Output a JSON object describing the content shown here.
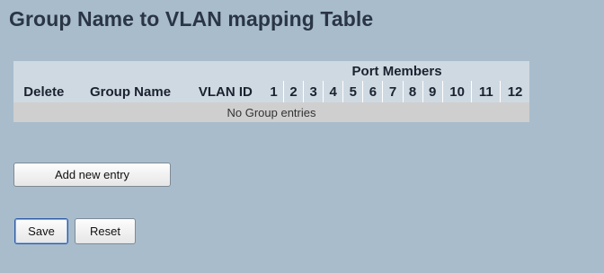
{
  "page": {
    "title": "Group Name to VLAN mapping Table"
  },
  "table": {
    "columns": {
      "delete": "Delete",
      "group_name": "Group Name",
      "vlan_id": "VLAN ID",
      "port_members": "Port Members"
    },
    "ports": [
      "1",
      "2",
      "3",
      "4",
      "5",
      "6",
      "7",
      "8",
      "9",
      "10",
      "11",
      "12"
    ],
    "empty_message": "No Group entries"
  },
  "buttons": {
    "add_new_entry": "Add new entry",
    "save": "Save",
    "reset": "Reset"
  },
  "colors": {
    "background": "#a8bccc",
    "table_header": "#cfd9e2",
    "empty_row": "#cfcfcf"
  }
}
